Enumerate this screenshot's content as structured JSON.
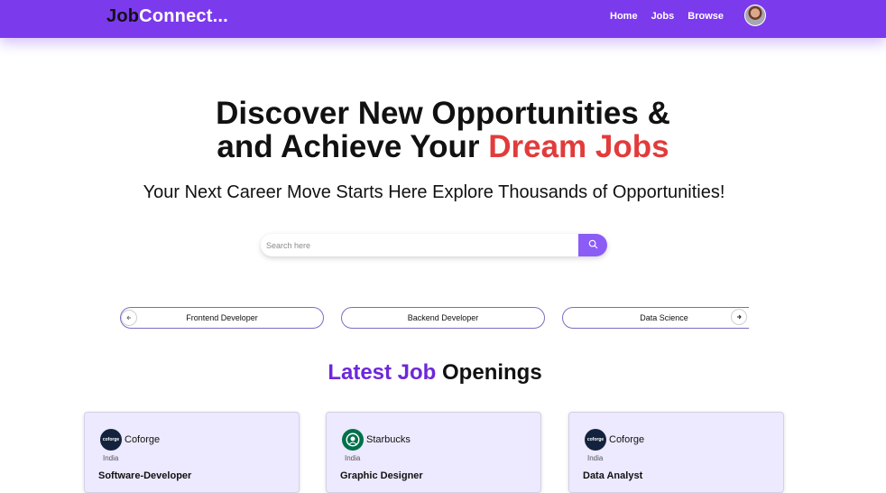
{
  "navbar": {
    "brand_part1": "Job",
    "brand_part2": "Connect...",
    "links": [
      "Home",
      "Jobs",
      "Browse"
    ]
  },
  "hero": {
    "title_line1": "Discover New Opportunities &",
    "title_line2_prefix": "and Achieve Your ",
    "title_line2_accent": "Dream Jobs",
    "subtitle": "Your Next Career Move Starts Here Explore Thousands of Opportunities!"
  },
  "search": {
    "placeholder": "Search here",
    "value": ""
  },
  "categories": [
    "Frontend Developer",
    "Backend Developer",
    "Data Science"
  ],
  "section": {
    "title_accent": "Latest Job",
    "title_rest": " Openings"
  },
  "jobs": [
    {
      "company": "Coforge",
      "location": "India",
      "title": "Software-Developer",
      "logo": "coforge-logo",
      "logo_text": "coforge"
    },
    {
      "company": "Starbucks",
      "location": "India",
      "title": "Graphic Designer",
      "logo": "starbucks-logo"
    },
    {
      "company": "Coforge",
      "location": "India",
      "title": "Data Analyst",
      "logo": "coforge-logo",
      "logo_text": "coforge"
    }
  ],
  "colors": {
    "brand": "#7c3aed",
    "accent_red": "#e23b3b",
    "section_accent": "#6d28d9",
    "card_bg": "#ede9fe"
  },
  "icons": {
    "search": "search-icon",
    "prev": "arrow-left-icon",
    "next": "arrow-right-icon"
  }
}
